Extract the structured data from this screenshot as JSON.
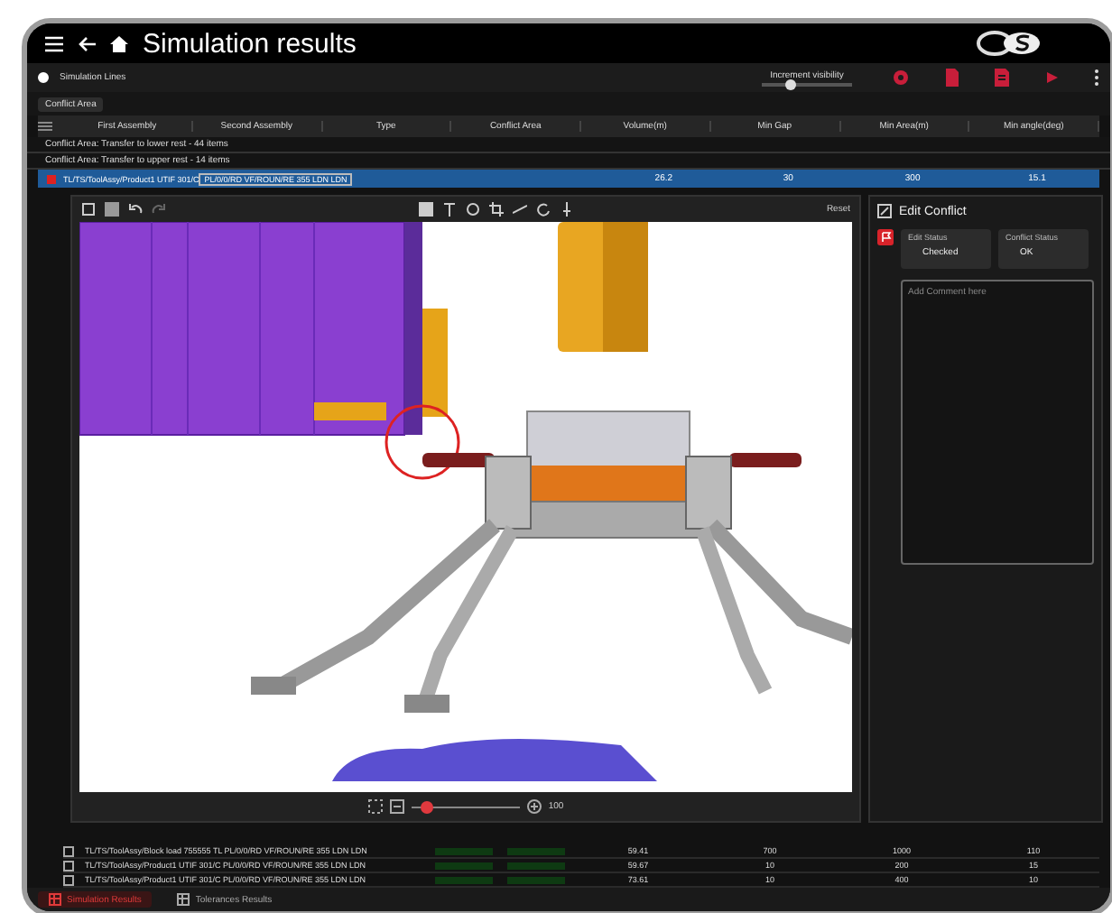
{
  "header": {
    "title": "Simulation results"
  },
  "toolbar": {
    "radio": {
      "label": "Simulation Lines",
      "selected": true
    },
    "visibility": {
      "label": "Increment visibility",
      "level": 0.3
    }
  },
  "filter_chip": "Conflict Area",
  "table": {
    "columns": [
      "First Assembly",
      "Second Assembly",
      "Type",
      "Conflict Area",
      "Volume(m)",
      "Min Gap",
      "Min Area(m)",
      "Min angle(deg)"
    ],
    "groups": [
      "Conflict Area: Transfer to lower rest - 44 items",
      "Conflict Area: Transfer to upper rest - 14 items"
    ],
    "rows": [
      {
        "cells": [
          "TL/TS/ToolAssy/Product1 UTIF 301/C",
          "PL/0/0/RD VF/ROUN/RE 355 LDN LDN",
          "",
          "",
          "26.2",
          "30",
          "300",
          "15.1"
        ],
        "selected": true
      }
    ]
  },
  "viewer": {
    "reset": "Reset",
    "zoom": {
      "level": 0.1,
      "reading": "100"
    }
  },
  "edit_conflict": {
    "title": "Edit Conflict",
    "fields": [
      {
        "label": "Edit Status",
        "value": "Checked"
      },
      {
        "label": "Conflict Status",
        "value": "OK"
      }
    ],
    "comment_placeholder": "Add Comment here"
  },
  "lower_rows": [
    {
      "checked": false,
      "first": "TL/TS/ToolAssy/Block load 755555 TL PL/0/0/RD VF/ROUN/RE 355 LDN LDN",
      "cells": [
        "59.41",
        "700",
        "1000",
        "110"
      ]
    },
    {
      "checked": false,
      "first": "TL/TS/ToolAssy/Product1 UTIF 301/C PL/0/0/RD VF/ROUN/RE 355 LDN LDN",
      "cells": [
        "59.67",
        "10",
        "200",
        "15"
      ]
    },
    {
      "checked": false,
      "first": "TL/TS/ToolAssy/Product1 UTIF 301/C PL/0/0/RD VF/ROUN/RE 355 LDN LDN",
      "cells": [
        "73.61",
        "10",
        "400",
        "10"
      ]
    }
  ],
  "bottom_tabs": [
    {
      "label": "Simulation Results",
      "selected": true
    },
    {
      "label": "Tolerances Results",
      "selected": false
    }
  ]
}
